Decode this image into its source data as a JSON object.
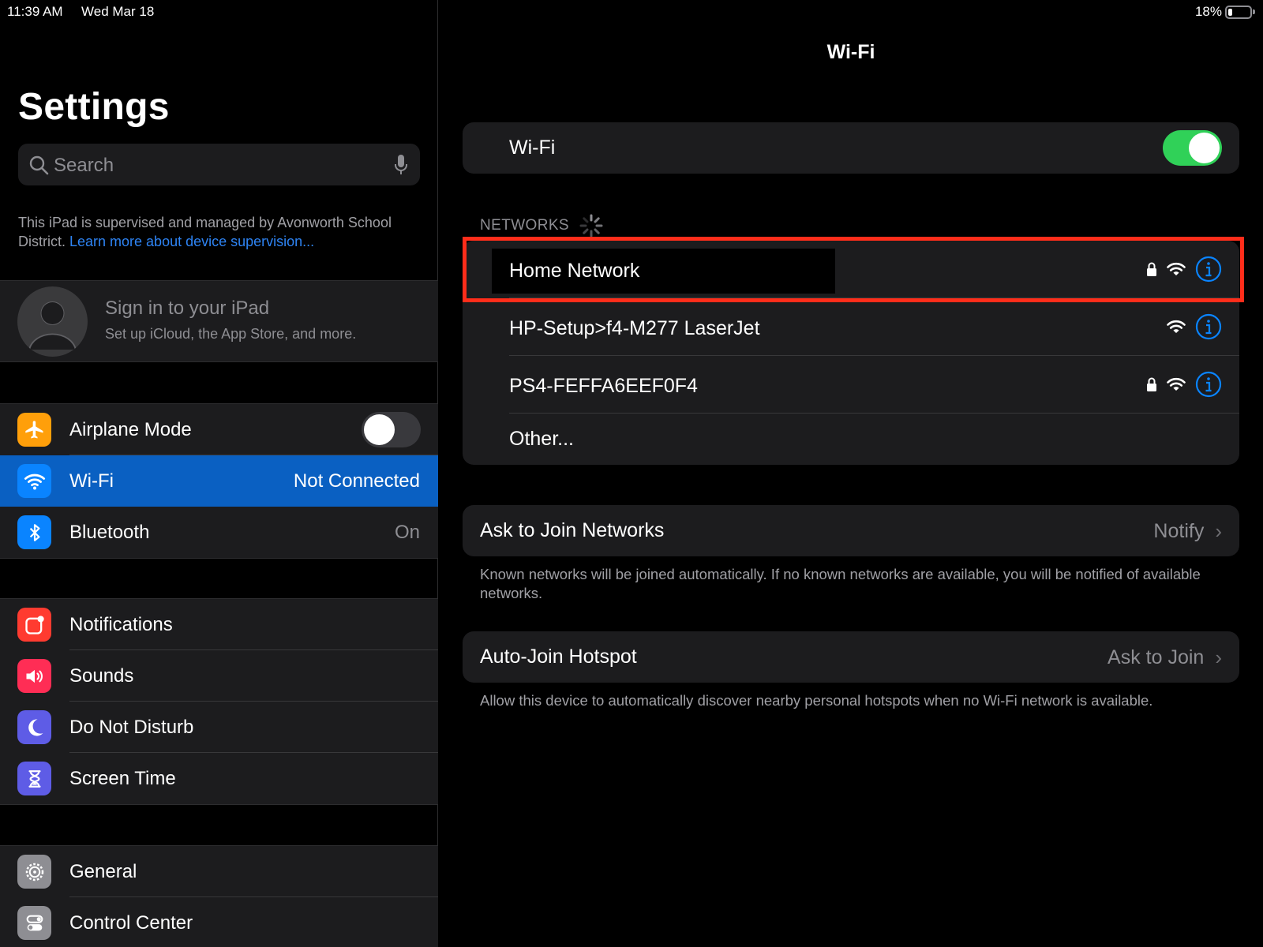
{
  "status": {
    "time": "11:39 AM",
    "date": "Wed Mar 18",
    "battery": "18%",
    "battery_level": 0.18
  },
  "sidebar": {
    "title": "Settings",
    "search_placeholder": "Search",
    "supervision_text": "This iPad is supervised and managed by Avonworth School District. ",
    "supervision_link": "Learn more about device supervision...",
    "account": {
      "title": "Sign in to your iPad",
      "subtitle": "Set up iCloud, the App Store, and more."
    },
    "group1": [
      {
        "label": "Airplane Mode",
        "value": "",
        "icon": "airplane-icon",
        "color": "#ff9f0a",
        "toggle": "off"
      },
      {
        "label": "Wi-Fi",
        "value": "Not Connected",
        "icon": "wifi-icon",
        "color": "#0a84ff",
        "selected": true
      },
      {
        "label": "Bluetooth",
        "value": "On",
        "icon": "bluetooth-icon",
        "color": "#0a84ff"
      }
    ],
    "group2": [
      {
        "label": "Notifications",
        "icon": "notifications-icon",
        "color": "#ff3b30"
      },
      {
        "label": "Sounds",
        "icon": "sounds-icon",
        "color": "#ff2d55"
      },
      {
        "label": "Do Not Disturb",
        "icon": "moon-icon",
        "color": "#5e5ce6"
      },
      {
        "label": "Screen Time",
        "icon": "hourglass-icon",
        "color": "#5e5ce6"
      }
    ],
    "group3": [
      {
        "label": "General",
        "icon": "gear-icon",
        "color": "#8e8e93"
      },
      {
        "label": "Control Center",
        "icon": "toggles-icon",
        "color": "#8e8e93"
      }
    ]
  },
  "detail": {
    "title": "Wi-Fi",
    "wifi_label": "Wi-Fi",
    "wifi_toggle": "on",
    "networks_header": "NETWORKS",
    "networks": [
      {
        "name": "Home Network",
        "locked": true
      },
      {
        "name": "HP-Setup>f4-M277 LaserJet",
        "locked": false
      },
      {
        "name": "PS4-FEFFA6EEF0F4",
        "locked": true
      }
    ],
    "other_label": "Other...",
    "ask_join": {
      "label": "Ask to Join Networks",
      "value": "Notify",
      "footnote": "Known networks will be joined automatically. If no known networks are available, you will be notified of available networks."
    },
    "auto_join": {
      "label": "Auto-Join Hotspot",
      "value": "Ask to Join",
      "footnote": "Allow this device to automatically discover nearby personal hotspots when no Wi-Fi network is available."
    }
  },
  "colors": {
    "accent": "#0a84ff",
    "toggle_on": "#30d158",
    "highlight": "#ff2d1a",
    "selected_row": "#0a60c2"
  }
}
